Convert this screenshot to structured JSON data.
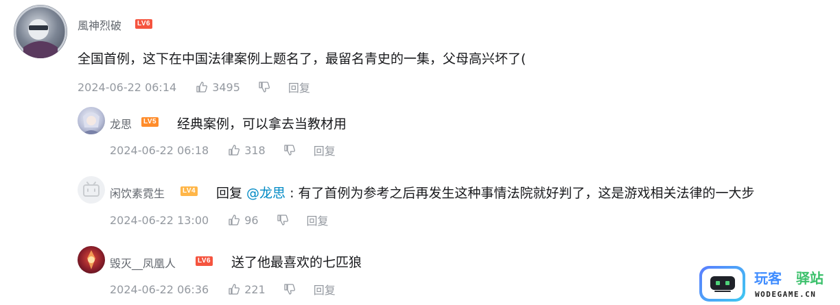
{
  "comments": [
    {
      "username": "風神烈破",
      "level": "LV6",
      "text": "全国首例，这下在中国法律案例上题名了，最留名青史的一集，父母高兴坏了(",
      "time": "2024-06-22 06:14",
      "likes": "3495",
      "reply_label": "回复"
    },
    {
      "username": "龙思",
      "level": "LV5",
      "text": "经典案例，可以拿去当教材用",
      "time": "2024-06-22 06:18",
      "likes": "318",
      "reply_label": "回复"
    },
    {
      "username": "闲饮素霓生",
      "level": "LV4",
      "reply_prefix": "回复 ",
      "mention": "@龙思",
      "text": " : 有了首例为参考之后再发生这种事情法院就好判了，这是游戏相关法律的一大步",
      "time": "2024-06-22 13:00",
      "likes": "96",
      "reply_label": "回复"
    },
    {
      "username": "毁灭__凤凰人",
      "level": "LV6",
      "text": "送了他最喜欢的七匹狼",
      "time": "2024-06-22 06:36",
      "likes": "221",
      "reply_label": "回复"
    }
  ],
  "watermark": {
    "brand_part1": "玩客",
    "brand_part2": "驿站",
    "domain": "WODEGAME.CN"
  },
  "colors": {
    "lv6": "#f5543f",
    "lv5": "#ff8c2b",
    "lv4": "#ffb648",
    "mention": "#008ac5",
    "brand_blue": "#3f8cff",
    "brand_green": "#3ac06a"
  }
}
